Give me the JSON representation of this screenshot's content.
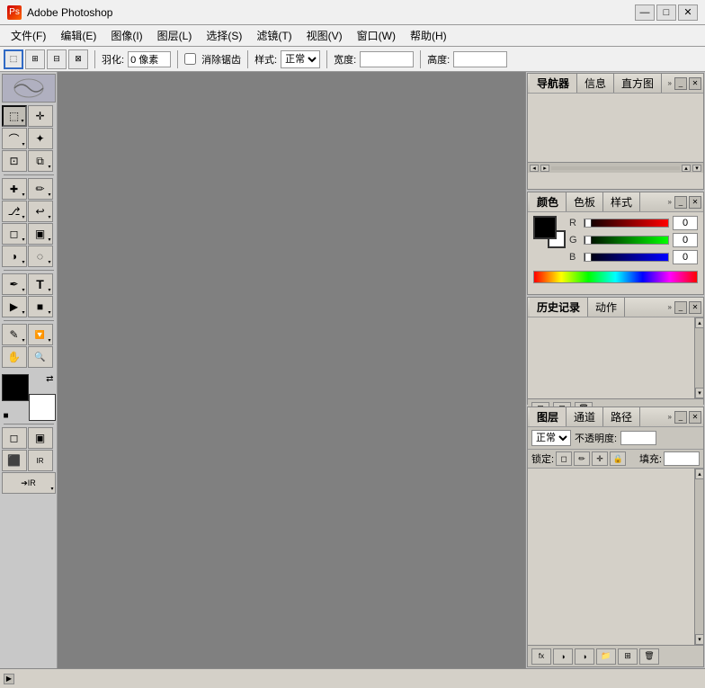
{
  "app": {
    "title": "Adobe Photoshop",
    "icon": "Ps"
  },
  "window_controls": {
    "minimize": "—",
    "maximize": "□",
    "close": "✕"
  },
  "menu": {
    "items": [
      "文件(F)",
      "编辑(E)",
      "图像(I)",
      "图层(L)",
      "选择(S)",
      "滤镜(T)",
      "视图(V)",
      "窗口(W)",
      "帮助(H)"
    ]
  },
  "options_bar": {
    "feather_label": "羽化:",
    "feather_value": "0 像素",
    "antialias_label": "消除锯齿",
    "style_label": "样式:",
    "style_value": "正常",
    "width_label": "宽度:",
    "height_label": "高度:"
  },
  "toolbox": {
    "tools": [
      {
        "id": "marquee",
        "icon": "⬚",
        "label": "矩形选框"
      },
      {
        "id": "move",
        "icon": "✛",
        "label": "移动"
      },
      {
        "id": "lasso",
        "icon": "⌒",
        "label": "套索"
      },
      {
        "id": "magic-wand",
        "icon": "✦",
        "label": "魔棒"
      },
      {
        "id": "crop",
        "icon": "⊡",
        "label": "裁剪"
      },
      {
        "id": "slice",
        "icon": "⧄",
        "label": "切片"
      },
      {
        "id": "heal",
        "icon": "✚",
        "label": "修复"
      },
      {
        "id": "brush",
        "icon": "✏",
        "label": "画笔"
      },
      {
        "id": "stamp",
        "icon": "⎆",
        "label": "仿制图章"
      },
      {
        "id": "history-brush",
        "icon": "↩",
        "label": "历史记录画笔"
      },
      {
        "id": "eraser",
        "icon": "◻",
        "label": "橡皮擦"
      },
      {
        "id": "gradient",
        "icon": "▣",
        "label": "渐变"
      },
      {
        "id": "dodge",
        "icon": "◑",
        "label": "减淡"
      },
      {
        "id": "pen",
        "icon": "✒",
        "label": "钢笔"
      },
      {
        "id": "text",
        "icon": "T",
        "label": "文字"
      },
      {
        "id": "path-select",
        "icon": "▶",
        "label": "路径选择"
      },
      {
        "id": "shape",
        "icon": "■",
        "label": "形状"
      },
      {
        "id": "notes",
        "icon": "✎",
        "label": "注释"
      },
      {
        "id": "eyedropper",
        "icon": "✓",
        "label": "吸管"
      },
      {
        "id": "hand",
        "icon": "✋",
        "label": "抓手"
      },
      {
        "id": "zoom",
        "icon": "🔍",
        "label": "缩放"
      }
    ]
  },
  "panels": {
    "navigator": {
      "tabs": [
        "导航器",
        "信息",
        "直方图"
      ],
      "active_tab": "导航器"
    },
    "color": {
      "tabs": [
        "颜色",
        "色板",
        "样式"
      ],
      "active_tab": "颜色",
      "r_value": "0",
      "g_value": "0",
      "b_value": "0"
    },
    "history": {
      "tabs": [
        "历史记录",
        "动作"
      ],
      "active_tab": "历史记录",
      "footer_btns": [
        "⊡",
        "⊞",
        "🗑"
      ]
    },
    "layers": {
      "tabs": [
        "图层",
        "通道",
        "路径"
      ],
      "active_tab": "图层",
      "blend_mode": "正常",
      "opacity_label": "不透明度:",
      "opacity_value": "",
      "lock_label": "锁定:",
      "fill_label": "填充:",
      "fill_value": "",
      "footer_btns": [
        "fx",
        "◑",
        "⊞",
        "🗑",
        "⊡",
        "⊞"
      ]
    }
  },
  "status_bar": {
    "scroll_btn": "▶"
  }
}
